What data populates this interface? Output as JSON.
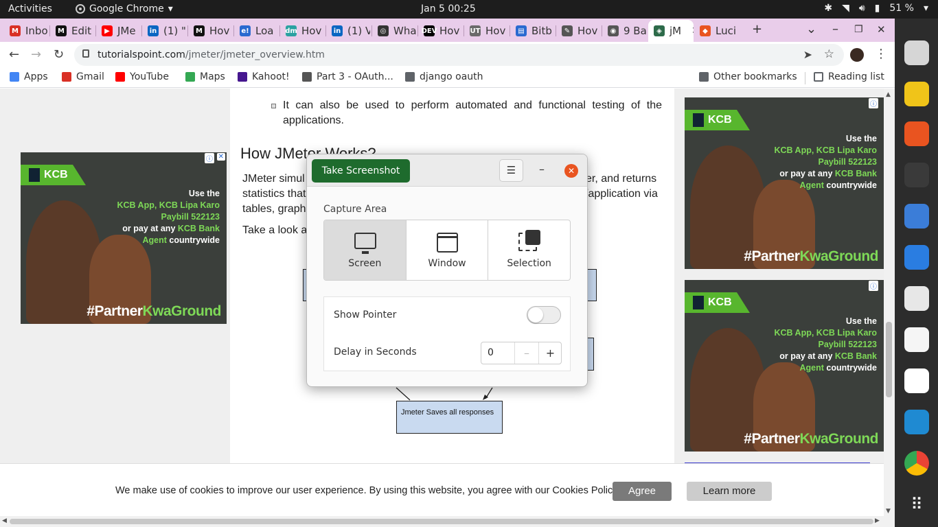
{
  "topbar": {
    "activities": "Activities",
    "app_name": "Google Chrome",
    "clock": "Jan 5  00:25",
    "battery": "51 %"
  },
  "tabs": [
    {
      "label": "Inbo",
      "color": "#d93025",
      "glyph": "M"
    },
    {
      "label": "Edit",
      "color": "#111111",
      "glyph": "M"
    },
    {
      "label": "JMe",
      "color": "#ff0000",
      "glyph": "▶"
    },
    {
      "label": "(1) \"",
      "color": "#0a66c2",
      "glyph": "in"
    },
    {
      "label": "Hov",
      "color": "#111111",
      "glyph": "M"
    },
    {
      "label": "Loa",
      "color": "#2a6ad0",
      "glyph": "e!"
    },
    {
      "label": "Hov",
      "color": "#2aa1a1",
      "glyph": "dm"
    },
    {
      "label": "(1) V",
      "color": "#0a66c2",
      "glyph": "in"
    },
    {
      "label": "Wha",
      "color": "#333333",
      "glyph": "◎"
    },
    {
      "label": "Hov",
      "color": "#000000",
      "glyph": "DEV"
    },
    {
      "label": "Hov",
      "color": "#6a6a6a",
      "glyph": "UT"
    },
    {
      "label": "Bitb",
      "color": "#2a6ad0",
      "glyph": "▤"
    },
    {
      "label": "Hov",
      "color": "#555555",
      "glyph": "✎"
    },
    {
      "label": "9 Ba",
      "color": "#555555",
      "glyph": "◉"
    },
    {
      "label": "jM",
      "color": "#2d6b4a",
      "glyph": "◈"
    },
    {
      "label": "Luci",
      "color": "#e95420",
      "glyph": "◆"
    }
  ],
  "tabstrip": {
    "new_tab": "+",
    "dropdown": "⌄",
    "minimize": "–",
    "restore": "❐",
    "close": "✕"
  },
  "toolbar": {
    "url_domain": "tutorialspoint.com",
    "url_path": "/jmeter/jmeter_overview.htm"
  },
  "bookmarks": [
    {
      "label": "Apps",
      "icon": "apps-grid-icon",
      "color": "#4285f4"
    },
    {
      "label": "Gmail",
      "icon": "gmail-icon",
      "color": "#d93025"
    },
    {
      "label": "YouTube",
      "icon": "youtube-icon",
      "color": "#ff0000"
    },
    {
      "label": "Maps",
      "icon": "maps-pin-icon",
      "color": "#34a853"
    },
    {
      "label": "Kahoot!",
      "icon": "kahoot-icon",
      "color": "#46178f"
    },
    {
      "label": "Part 3 - OAuth...",
      "icon": "page-icon",
      "color": "#555555"
    },
    {
      "label": "django oauth",
      "icon": "folder-icon",
      "color": "#5f6368"
    }
  ],
  "bookmarks_right": {
    "other": "Other bookmarks",
    "reading": "Reading list"
  },
  "article": {
    "bullet": "It can also be used to perform automated and functional testing of the applications.",
    "heading": "How JMeter Works?",
    "para1_line1_left": "JMeter simul",
    "para1_line1_right": "er, and returns",
    "para1_line2_left": "statistics that",
    "para1_line2_right": "/application via",
    "para1_line3_left": "tables, graph",
    "para2_left": "Take a look a",
    "diagram_box": "Jmeter Saves all responses"
  },
  "ad": {
    "brand": "KCB",
    "line1": "Use the",
    "line2": "KCB App, KCB Lipa Karo",
    "line3": "Paybill 522123",
    "line4a": "or pay at any ",
    "line4b": "KCB Bank",
    "line5a": "Agent",
    "line5b": " countrywide",
    "tag_a": "#Partner",
    "tag_b": "Kwa",
    "tag_c": "Ground"
  },
  "cookie": {
    "message": "We make use of cookies to improve our user experience. By using this website, you agree with our Cookies Policy.",
    "agree": "Agree",
    "learn": "Learn more"
  },
  "dialog": {
    "take_screenshot": "Take Screenshot",
    "menu": "☰",
    "minimize": "–",
    "close": "✕",
    "capture_area": "Capture Area",
    "modes": [
      "Screen",
      "Window",
      "Selection"
    ],
    "selected_mode": "Screen",
    "show_pointer": "Show Pointer",
    "show_pointer_on": false,
    "delay_label": "Delay in Seconds",
    "delay_value": "0",
    "minus": "–",
    "plus": "+"
  },
  "dock": [
    {
      "name": "search-app-icon",
      "color": "#d6d6d6"
    },
    {
      "name": "rhythmbox-icon",
      "color": "#f0c419"
    },
    {
      "name": "software-center-icon",
      "color": "#e95420"
    },
    {
      "name": "terminal-icon",
      "color": "#3a3a3a"
    },
    {
      "name": "archive-manager-icon",
      "color": "#3b7dd8"
    },
    {
      "name": "thunderbird-icon",
      "color": "#2a7de1"
    },
    {
      "name": "document-viewer-icon",
      "color": "#e7e7e7"
    },
    {
      "name": "text-editor-icon",
      "color": "#f5f5f5"
    },
    {
      "name": "slack-icon",
      "color": "#ffffff"
    },
    {
      "name": "vscode-icon",
      "color": "#1f8ad2"
    },
    {
      "name": "chrome-icon",
      "color": "#ffffff"
    },
    {
      "name": "show-apps-icon",
      "color": "#2c2c2c"
    }
  ]
}
